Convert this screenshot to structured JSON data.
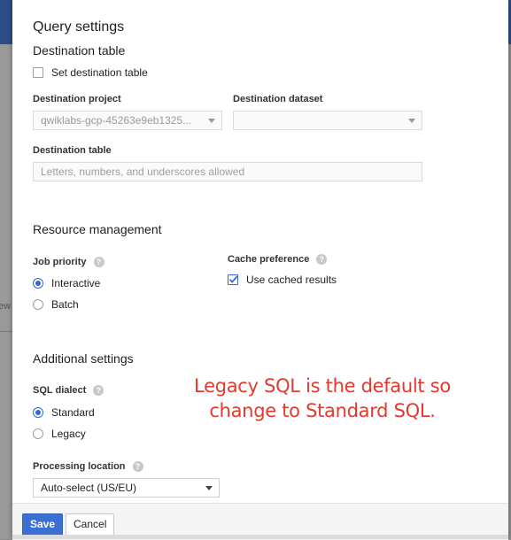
{
  "dialog": {
    "title": "Query settings",
    "destination": {
      "section_title": "Destination table",
      "set_destination_label": "Set destination table",
      "set_destination_checked": false,
      "project_label": "Destination project",
      "project_value": "qwiklabs-gcp-45263e9eb1325...",
      "dataset_label": "Destination dataset",
      "dataset_value": "",
      "table_label": "Destination table",
      "table_placeholder": "Letters, numbers, and underscores allowed"
    },
    "resource": {
      "section_title": "Resource management",
      "job_priority_label": "Job priority",
      "options": [
        "Interactive",
        "Batch"
      ],
      "selected": "Interactive",
      "cache_label": "Cache preference",
      "cache_option": "Use cached results",
      "cache_checked": true
    },
    "additional": {
      "section_title": "Additional settings",
      "sql_dialect_label": "SQL dialect",
      "dialect_options": [
        "Standard",
        "Legacy"
      ],
      "dialect_selected": "Standard",
      "processing_label": "Processing location",
      "processing_value": "Auto-select (US/EU)"
    },
    "help_glyph": "?",
    "buttons": {
      "save": "Save",
      "cancel": "Cancel"
    }
  },
  "annotation": {
    "line1": "Legacy SQL is the default so",
    "line2": "change to Standard SQL."
  },
  "background": {
    "left_fragment": "ew"
  },
  "colors": {
    "accent": "#3367d6",
    "annotation": "#e23a2e",
    "topbar": "#2b4d89"
  }
}
